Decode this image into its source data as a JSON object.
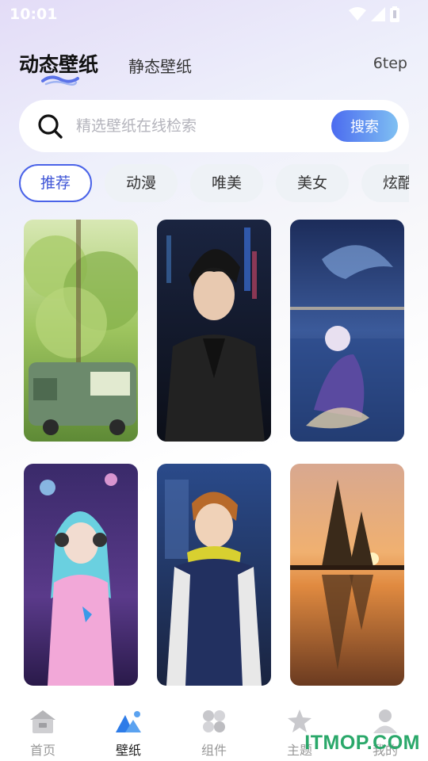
{
  "status_bar": {
    "time": "10:01"
  },
  "header": {
    "tab_dynamic": "动态壁纸",
    "tab_static": "静态壁纸",
    "top_right": "6tep"
  },
  "search": {
    "placeholder": "精选壁纸在线检索",
    "value": "",
    "button_label": "搜索"
  },
  "categories": [
    {
      "label": "推荐",
      "active": true
    },
    {
      "label": "动漫",
      "active": false
    },
    {
      "label": "唯美",
      "active": false
    },
    {
      "label": "美女",
      "active": false
    },
    {
      "label": "炫酷",
      "active": false
    }
  ],
  "wallpapers": [
    {
      "subject": "green tree with vintage bus",
      "colors": [
        "#bcd98a",
        "#6f9a3c"
      ]
    },
    {
      "subject": "anime boy in black jacket neon city",
      "colors": [
        "#1c2338",
        "#2b3d6a"
      ]
    },
    {
      "subject": "fantasy girl by sea with whale",
      "colors": [
        "#233a6a",
        "#8aa8d8"
      ]
    },
    {
      "subject": "anime singer girl with headphones on stage",
      "colors": [
        "#4b2d7a",
        "#e99bd8"
      ]
    },
    {
      "subject": "anime boy in varsity jacket yellow scarf",
      "colors": [
        "#2d3f6e",
        "#d7c84a"
      ]
    },
    {
      "subject": "sunset lake tree reflection",
      "colors": [
        "#e0a86a",
        "#7a4a2a"
      ]
    }
  ],
  "bottom_nav": [
    {
      "label": "首页",
      "icon": "home-icon",
      "active": false
    },
    {
      "label": "壁纸",
      "icon": "wallpaper-icon",
      "active": true
    },
    {
      "label": "组件",
      "icon": "widget-icon",
      "active": false
    },
    {
      "label": "主题",
      "icon": "theme-icon",
      "active": false
    },
    {
      "label": "我的",
      "icon": "profile-icon",
      "active": false
    }
  ],
  "watermark": "ITMOP.COM",
  "colors": {
    "accent": "#4a63e8",
    "watermark": "#2aa86a"
  }
}
